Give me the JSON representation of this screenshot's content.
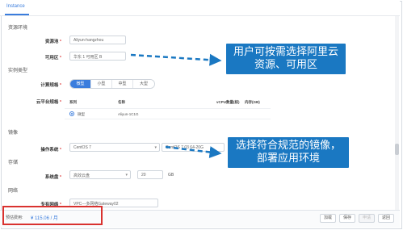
{
  "tab": {
    "label": "Instance"
  },
  "sections": {
    "resource_env": "资源环境",
    "instance_type": "实例类型",
    "image": "镜像",
    "storage": "存储",
    "network": "网络"
  },
  "resource_pool": {
    "label": "资源池",
    "value": "Aliyun-hangzhou"
  },
  "zone": {
    "label": "可用区",
    "value": "华东 1 可用区 B"
  },
  "spec": {
    "label": "计算规格",
    "options": [
      "微型",
      "小型",
      "中型",
      "大型"
    ],
    "selected": "微型"
  },
  "cloud_spec": {
    "label": "云平台规格",
    "columns": [
      "系列",
      "名称",
      "vCPU数量(核)",
      "内存(GB)"
    ],
    "row": {
      "series": "微型",
      "name": "Aliyun-1C1G"
    }
  },
  "os": {
    "label": "操作系统",
    "value": "CentOS 7",
    "version": "CentOS 7.03 64-20G"
  },
  "system_disk": {
    "label": "系统盘",
    "type": "高效云盘",
    "size": "20",
    "unit": "GB"
  },
  "vpc": {
    "label": "专有网络",
    "value": "VPC---多网络Gateway02"
  },
  "callouts": {
    "first": "用户可按需选择阿里云资源、可用区",
    "second": "选择符合规范的镜像，部署应用环境"
  },
  "footer": {
    "price_label": "预估费用:",
    "price_value": "¥ 115.06 / 月",
    "buttons": [
      "加载",
      "保存",
      "申请",
      "返回"
    ]
  },
  "colors": {
    "accent": "#3b7ddd",
    "callout": "#1a78c2",
    "highlight_border": "#d9322f"
  }
}
